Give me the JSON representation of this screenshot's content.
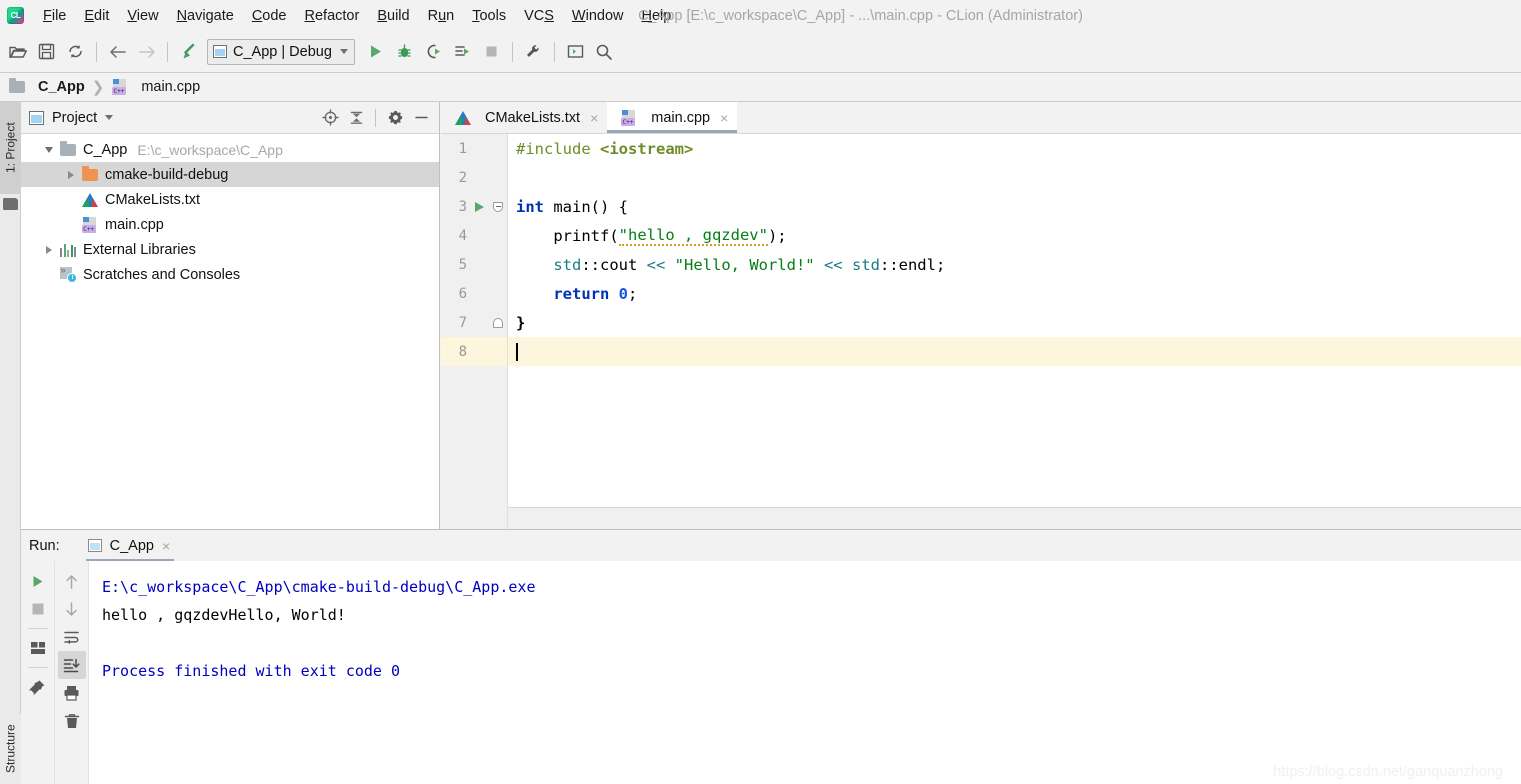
{
  "window": {
    "title": "C_App [E:\\c_workspace\\C_App] - ...\\main.cpp - CLion (Administrator)",
    "app_icon": "clion-logo-icon"
  },
  "menubar": {
    "items": [
      {
        "label": "File",
        "mnemonic": "F"
      },
      {
        "label": "Edit",
        "mnemonic": "E"
      },
      {
        "label": "View",
        "mnemonic": "V"
      },
      {
        "label": "Navigate",
        "mnemonic": "N"
      },
      {
        "label": "Code",
        "mnemonic": "C"
      },
      {
        "label": "Refactor",
        "mnemonic": "R"
      },
      {
        "label": "Build",
        "mnemonic": "B"
      },
      {
        "label": "Run",
        "mnemonic": "R"
      },
      {
        "label": "Tools",
        "mnemonic": "T"
      },
      {
        "label": "VCS",
        "mnemonic": "S"
      },
      {
        "label": "Window",
        "mnemonic": "W"
      },
      {
        "label": "Help",
        "mnemonic": "H"
      }
    ]
  },
  "toolbar": {
    "buttons": [
      {
        "name": "open-folder-icon",
        "title": "Open"
      },
      {
        "name": "save-all-icon",
        "title": "Save All"
      },
      {
        "name": "sync-refresh-icon",
        "title": "Synchronize"
      },
      {
        "name": "back-arrow-icon",
        "title": "Back"
      },
      {
        "name": "forward-arrow-icon",
        "title": "Forward"
      },
      {
        "name": "build-hammer-icon",
        "title": "Build"
      }
    ],
    "run_config": {
      "label": "C_App | Debug",
      "icon": "run-configuration-icon",
      "dropdown": "chevron-down-icon"
    },
    "run_buttons": [
      {
        "name": "run-icon",
        "title": "Run"
      },
      {
        "name": "debug-icon",
        "title": "Debug"
      },
      {
        "name": "run-with-coverage-icon",
        "title": "Run with Coverage"
      },
      {
        "name": "profile-icon",
        "title": "Profile"
      },
      {
        "name": "stop-icon",
        "title": "Stop"
      }
    ],
    "right_buttons": [
      {
        "name": "settings-wrench-icon",
        "title": "Settings"
      },
      {
        "name": "terminal-icon",
        "title": "Terminal"
      },
      {
        "name": "search-icon",
        "title": "Search Everywhere"
      }
    ]
  },
  "breadcrumb": {
    "items": [
      {
        "label": "C_App",
        "icon": "folder-icon",
        "bold": true
      },
      {
        "label": "main.cpp",
        "icon": "cpp-file-icon",
        "bold": false
      }
    ],
    "separator": "❯"
  },
  "left_strip": {
    "project_tab": "1: Project",
    "structure_tab": "Structure"
  },
  "project_panel": {
    "title": "Project",
    "title_dropdown": "chevron-down-icon",
    "actions": [
      {
        "name": "scroll-from-source-icon",
        "title": "Select Opened File"
      },
      {
        "name": "collapse-all-icon",
        "title": "Collapse All"
      },
      {
        "name": "gear-icon",
        "title": "Settings"
      },
      {
        "name": "hide-icon",
        "title": "Hide"
      }
    ],
    "tree": [
      {
        "label": "C_App",
        "sub": "E:\\c_workspace\\C_App",
        "icon": "folder-grey-icon",
        "twisty": "expanded",
        "indent": 0,
        "selected": false
      },
      {
        "label": "cmake-build-debug",
        "sub": "",
        "icon": "folder-orange-icon",
        "twisty": "collapsed",
        "indent": 1,
        "selected": true
      },
      {
        "label": "CMakeLists.txt",
        "sub": "",
        "icon": "cmake-file-icon",
        "twisty": "none",
        "indent": 1,
        "selected": false
      },
      {
        "label": "main.cpp",
        "sub": "",
        "icon": "cpp-file-icon",
        "twisty": "none",
        "indent": 1,
        "selected": false
      },
      {
        "label": "External Libraries",
        "sub": "",
        "icon": "libraries-icon",
        "twisty": "collapsed",
        "indent": 0,
        "selected": false
      },
      {
        "label": "Scratches and Consoles",
        "sub": "",
        "icon": "scratches-icon",
        "twisty": "none",
        "indent": 0,
        "selected": false
      }
    ]
  },
  "editor": {
    "tabs": [
      {
        "label": "CMakeLists.txt",
        "icon": "cmake-file-icon",
        "active": false,
        "close": "×"
      },
      {
        "label": "main.cpp",
        "icon": "cpp-file-icon",
        "active": true,
        "close": "×"
      }
    ],
    "lines": [
      {
        "num": "1",
        "gutter": "",
        "fold": "",
        "current": false
      },
      {
        "num": "2",
        "gutter": "",
        "fold": "",
        "current": false
      },
      {
        "num": "3",
        "gutter": "run-icon",
        "fold": "fold-open",
        "current": false
      },
      {
        "num": "4",
        "gutter": "",
        "fold": "",
        "current": false
      },
      {
        "num": "5",
        "gutter": "",
        "fold": "",
        "current": false
      },
      {
        "num": "6",
        "gutter": "",
        "fold": "",
        "current": false
      },
      {
        "num": "7",
        "gutter": "",
        "fold": "fold-close",
        "current": false
      },
      {
        "num": "8",
        "gutter": "",
        "fold": "",
        "current": true
      }
    ],
    "code": {
      "l1_include": "#include",
      "l1_header": "<iostream>",
      "l3_int": "int",
      "l3_main": " main() {",
      "l4_printf": "    printf(",
      "l4_str": "\"hello , gqzdev\"",
      "l4_end": ");",
      "l5_std": "    std",
      "l5_cout": "::cout ",
      "l5_shift1": "<<",
      "l5_str": " \"Hello, World!\" ",
      "l5_shift2": "<<",
      "l5_std2": " std",
      "l5_endl": "::endl;",
      "l6_return": "    return",
      "l6_zero": " 0",
      "l6_semi": ";",
      "l7_brace": "}"
    }
  },
  "run_panel": {
    "label": "Run:",
    "tab": {
      "label": "C_App",
      "icon": "run-configuration-icon",
      "close": "×"
    },
    "tools_left": [
      {
        "name": "rerun-icon",
        "title": "Rerun",
        "active": false
      },
      {
        "name": "stop-icon",
        "title": "Stop",
        "active": false
      },
      {
        "name": "layout-icon",
        "title": "Layout",
        "active": false
      },
      {
        "name": "pin-icon",
        "title": "Pin Tab",
        "active": false
      }
    ],
    "tools_right": [
      {
        "name": "arrow-up-icon",
        "title": "Up",
        "active": false
      },
      {
        "name": "arrow-down-icon",
        "title": "Down",
        "active": false
      },
      {
        "name": "soft-wrap-icon",
        "title": "Soft-Wrap",
        "active": false
      },
      {
        "name": "scroll-to-end-icon",
        "title": "Scroll to End",
        "active": true
      },
      {
        "name": "print-icon",
        "title": "Print",
        "active": false
      },
      {
        "name": "trash-icon",
        "title": "Clear All",
        "active": false
      }
    ],
    "console": {
      "line1": "E:\\c_workspace\\C_App\\cmake-build-debug\\C_App.exe",
      "line2": "hello , gqzdevHello, World!",
      "line3": "",
      "line4": "Process finished with exit code 0"
    }
  },
  "watermark": "https://blog.csdn.net/ganquanzhong",
  "colors": {
    "accent_green": "#59a869",
    "selection_grey": "#d6d6d6",
    "current_line": "#fdf6dd",
    "keyword_blue": "#0033b3",
    "string_green": "#067d17",
    "namespace_teal": "#1d7c86",
    "directive_olive": "#6f8c27",
    "console_blue": "#0000c0",
    "folder_orange": "#ef9350"
  }
}
